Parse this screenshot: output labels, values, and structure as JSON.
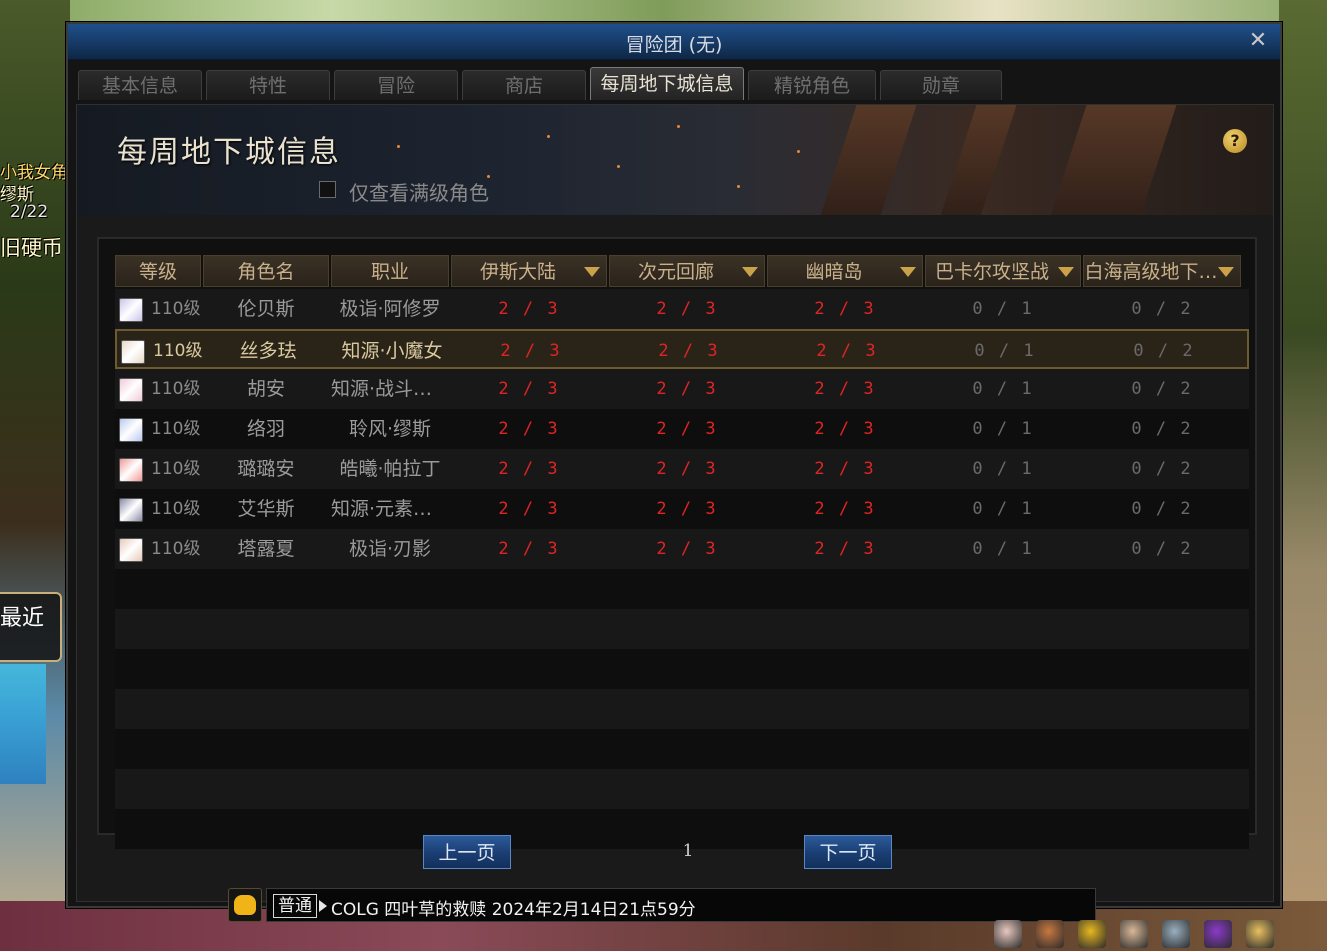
{
  "window": {
    "title": "冒险团 (无)",
    "close_symbol": "✕"
  },
  "left_overlay": {
    "line1": "小我女角",
    "line2": "缪斯",
    "line3": "2/22",
    "line4": "旧硬币",
    "recent": "最近"
  },
  "tabs": [
    {
      "label": "基本信息",
      "active": false
    },
    {
      "label": "特性",
      "active": false
    },
    {
      "label": "冒险",
      "active": false
    },
    {
      "label": "商店",
      "active": false
    },
    {
      "label": "每周地下城信息",
      "active": true
    },
    {
      "label": "精锐角色",
      "active": false
    },
    {
      "label": "勋章",
      "active": false
    }
  ],
  "page": {
    "title": "每周地下城信息",
    "help_symbol": "?",
    "filter_label": "仅查看满级角色",
    "filter_checked": false
  },
  "table": {
    "columns": [
      {
        "label": "等级",
        "sortable": false
      },
      {
        "label": "角色名",
        "sortable": false
      },
      {
        "label": "职业",
        "sortable": false
      },
      {
        "label": "伊斯大陆",
        "sortable": true
      },
      {
        "label": "次元回廊",
        "sortable": true
      },
      {
        "label": "幽暗岛",
        "sortable": true
      },
      {
        "label": "巴卡尔攻坚战",
        "sortable": true
      },
      {
        "label": "白海高级地下…",
        "sortable": true
      }
    ],
    "rows": [
      {
        "level": "110级",
        "name": "伦贝斯",
        "job": "极诣·阿修罗",
        "c1": "2 / 3",
        "c2": "2 / 3",
        "c3": "2 / 3",
        "c4": "0 / 1",
        "c5": "0 / 2",
        "avatar_color": "#c9c3e8",
        "selected": false
      },
      {
        "level": "110级",
        "name": "丝多珐",
        "job": "知源·小魔女",
        "c1": "2 / 3",
        "c2": "2 / 3",
        "c3": "2 / 3",
        "c4": "0 / 1",
        "c5": "0 / 2",
        "avatar_color": "#e8d8c8",
        "selected": true
      },
      {
        "level": "110级",
        "name": "胡安",
        "job": "知源·战斗法…",
        "c1": "2 / 3",
        "c2": "2 / 3",
        "c3": "2 / 3",
        "c4": "0 / 1",
        "c5": "0 / 2",
        "avatar_color": "#f0c8d8",
        "selected": false
      },
      {
        "level": "110级",
        "name": "络羽",
        "job": "聆风·缪斯",
        "c1": "2 / 3",
        "c2": "2 / 3",
        "c3": "2 / 3",
        "c4": "0 / 1",
        "c5": "0 / 2",
        "avatar_color": "#b8c8f0",
        "selected": false
      },
      {
        "level": "110级",
        "name": "璐璐安",
        "job": "皓曦·帕拉丁",
        "c1": "2 / 3",
        "c2": "2 / 3",
        "c3": "2 / 3",
        "c4": "0 / 1",
        "c5": "0 / 2",
        "avatar_color": "#f09898",
        "selected": false
      },
      {
        "level": "110级",
        "name": "艾华斯",
        "job": "知源·元素爆…",
        "c1": "2 / 3",
        "c2": "2 / 3",
        "c3": "2 / 3",
        "c4": "0 / 1",
        "c5": "0 / 2",
        "avatar_color": "#8a8aa8",
        "selected": false
      },
      {
        "level": "110级",
        "name": "塔露夏",
        "job": "极诣·刃影",
        "c1": "2 / 3",
        "c2": "2 / 3",
        "c3": "2 / 3",
        "c4": "0 / 1",
        "c5": "0 / 2",
        "avatar_color": "#e8c8b8",
        "selected": false
      }
    ],
    "total_row_slots": 14
  },
  "pager": {
    "prev_label": "上一页",
    "next_label": "下一页",
    "page": "1"
  },
  "chat": {
    "channel": "普通",
    "message": "COLG 四叶草的救赎 2024年2月14日21点59分"
  },
  "toolbar_icons": [
    {
      "name": "character-portrait-icon",
      "color": "#e8c8c0"
    },
    {
      "name": "inventory-grid-icon",
      "color": "#c87840"
    },
    {
      "name": "crown-icon",
      "color": "#e8b820"
    },
    {
      "name": "adventurer-face-icon",
      "color": "#d8b898"
    },
    {
      "name": "map-pin-icon",
      "color": "#9ab0c0"
    },
    {
      "name": "portal-orb-icon",
      "color": "#8a3ac8"
    },
    {
      "name": "settings-sun-icon",
      "color": "#e8c060"
    }
  ]
}
